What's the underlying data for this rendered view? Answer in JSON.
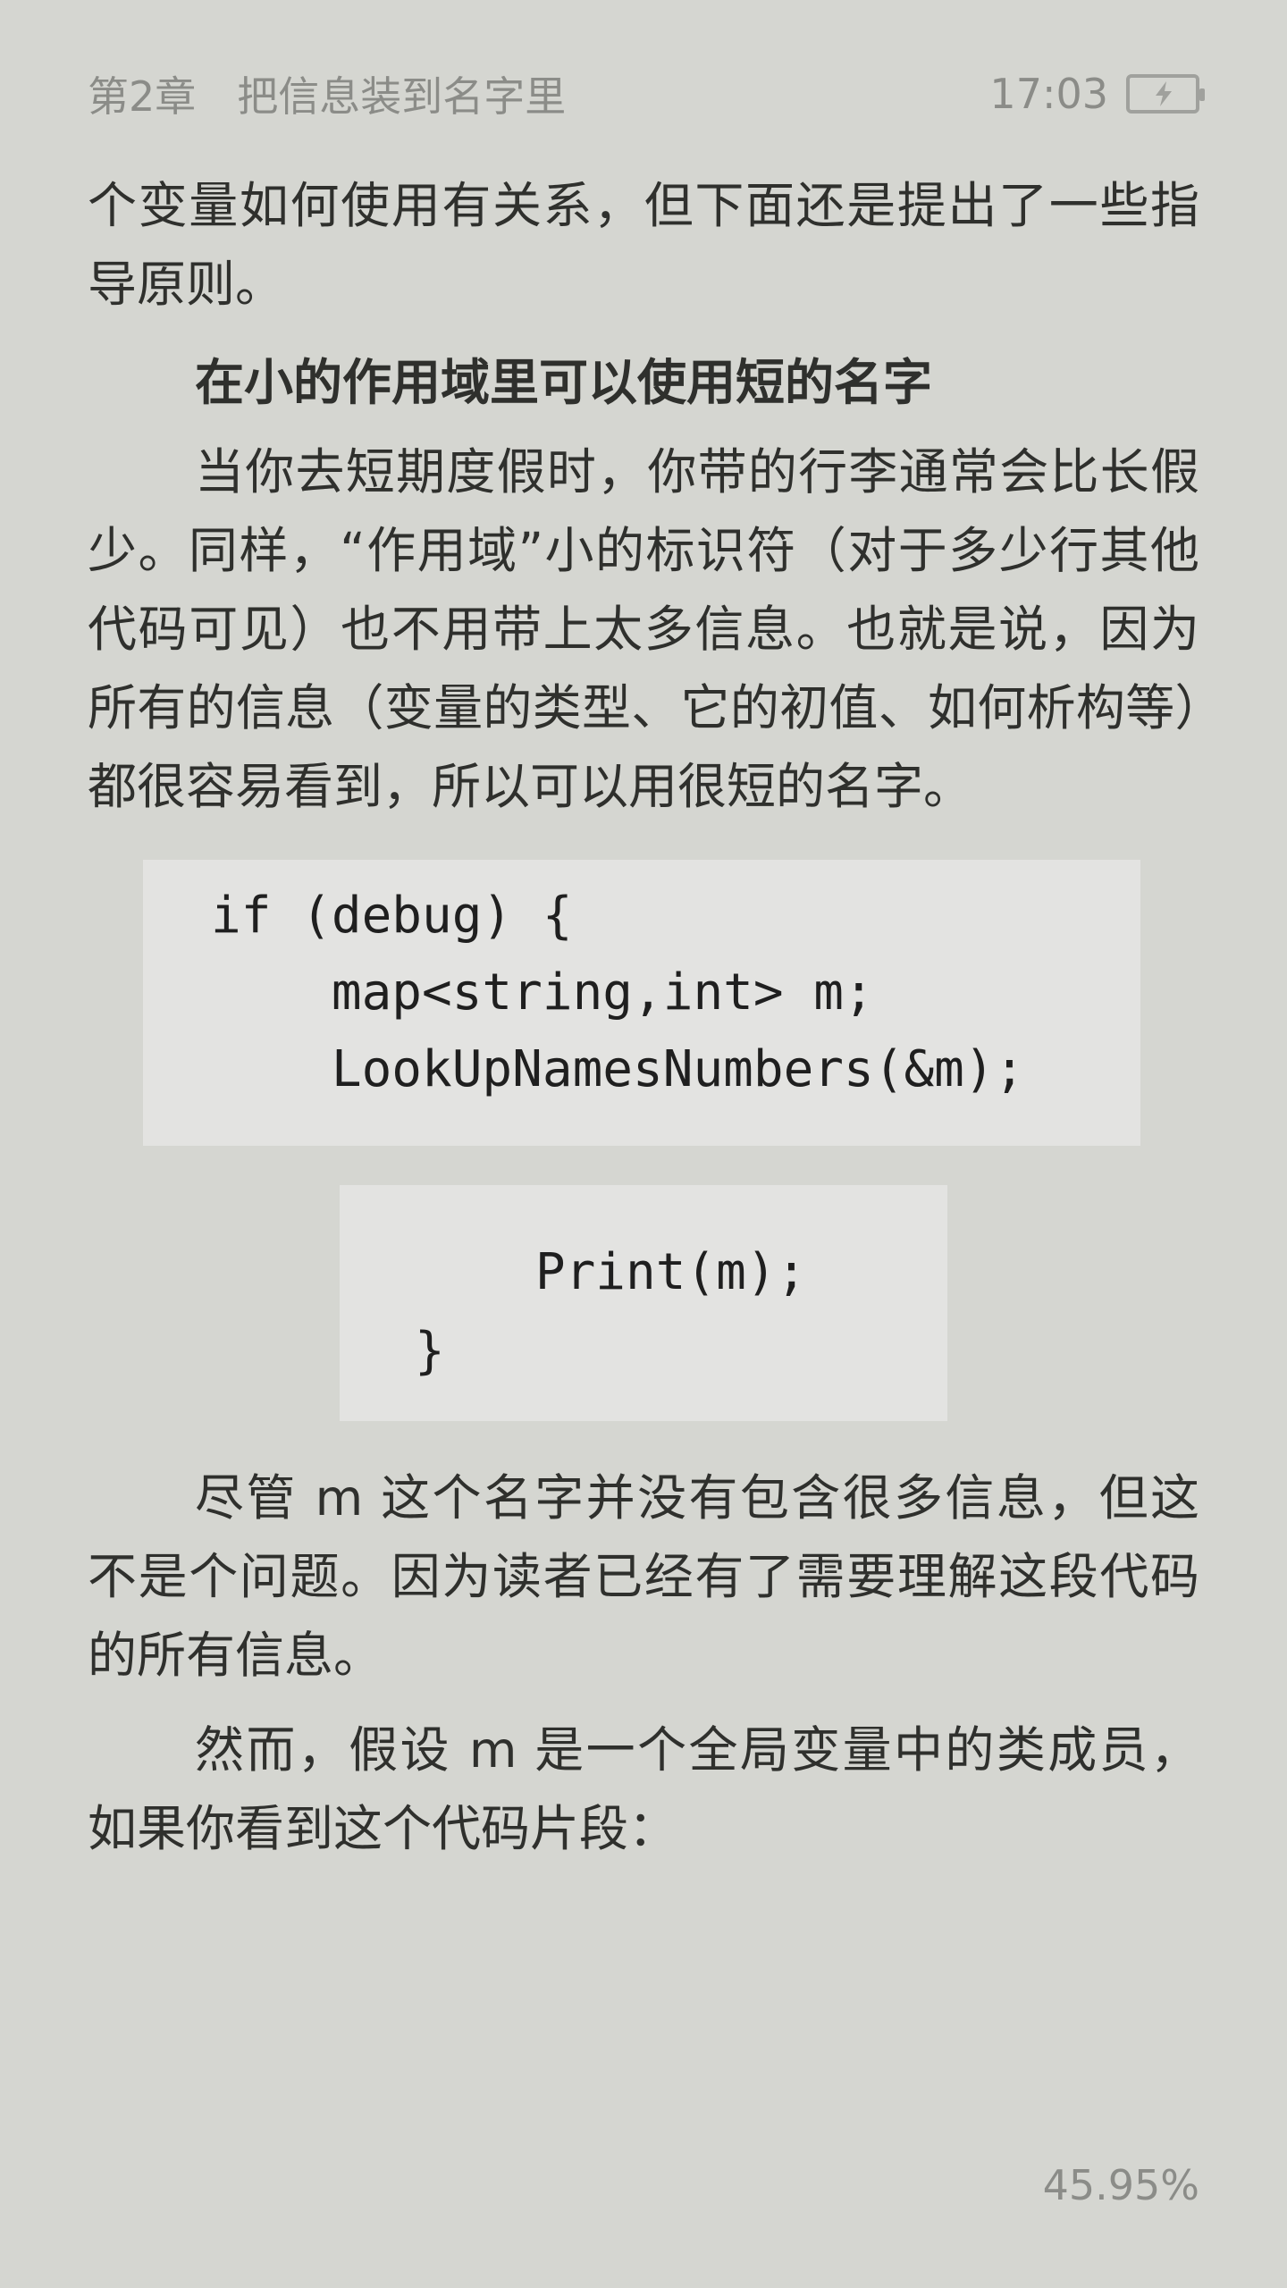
{
  "status_bar": {
    "chapter": "第2章　把信息装到名字里",
    "time": "17:03",
    "battery_icon": "battery-charging-icon"
  },
  "content": {
    "p1": "个变量如何使用有关系，但下面还是提出了一些指导原则。",
    "heading": "在小的作用域里可以使用短的名字",
    "p2": "当你去短期度假时，你带的行李通常会比长假少。同样，“作用域”小的标识符（对于多少行其他代码可见）也不用带上太多信息。也就是说，因为所有的信息（变量的类型、它的初值、如何析构等）都很容易看到，所以可以用很短的名字。",
    "code1": [
      "if (debug) {",
      "    map<string,int> m;",
      "    LookUpNamesNumbers(&m);"
    ],
    "code2": [
      "    Print(m);",
      "}"
    ],
    "p3": "尽管 m 这个名字并没有包含很多信息，但这不是个问题。因为读者已经有了需要理解这段代码的所有信息。",
    "p4": "然而，假设 m 是一个全局变量中的类成员，如果你看到这个代码片段："
  },
  "footer": {
    "progress": "45.95%"
  }
}
